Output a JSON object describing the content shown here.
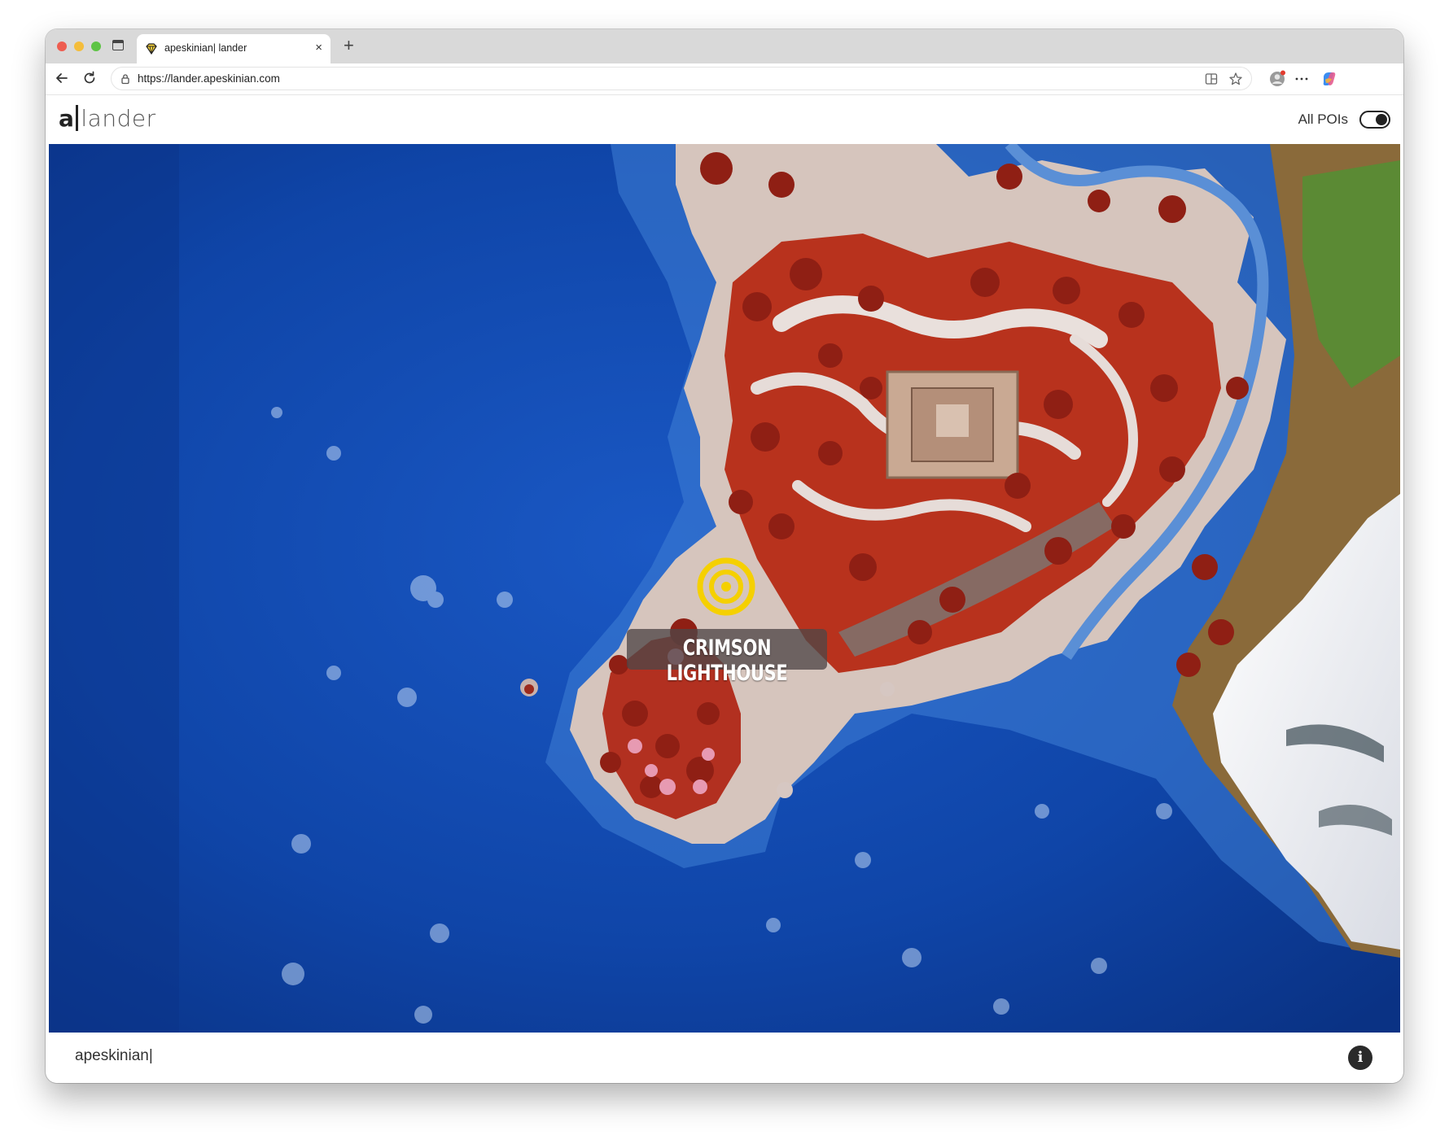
{
  "browser": {
    "tab_title": "apeskinian| lander",
    "tab_close": "×",
    "new_tab": "+",
    "url": "https://lander.apeskinian.com"
  },
  "app": {
    "logo_a": "a",
    "logo_word": "lander",
    "toggle_label": "All POIs",
    "toggle_on": true
  },
  "map": {
    "poi": {
      "name": "CRIMSON LIGHTHOUSE",
      "marker_color": "#f5d000"
    },
    "colors": {
      "ocean": "#0d3f9c",
      "land_red": "#b8321d",
      "sand": "#d8c7c0",
      "snow": "#f2f2f4"
    }
  },
  "footer": {
    "brand": "apeskinian|",
    "info_icon": "info-icon"
  }
}
